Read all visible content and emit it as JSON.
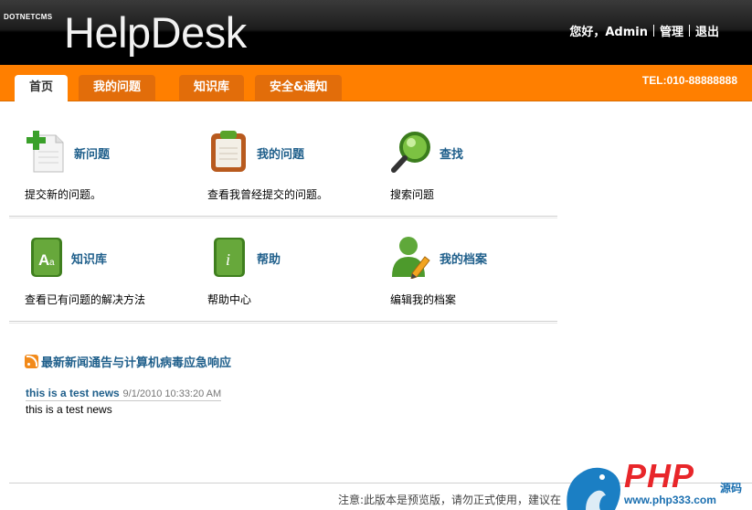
{
  "header": {
    "brand_small": "Dotnetcms",
    "brand_big": "HelpDesk",
    "greeting": "您好，Admin",
    "manage": "管理",
    "logout": "退出"
  },
  "nav": {
    "tabs": [
      {
        "label": "首页"
      },
      {
        "label": "我的问题"
      },
      {
        "label": "知识库"
      },
      {
        "label": "安全&通知"
      }
    ],
    "tel": "TEL:010-88888888"
  },
  "features": [
    {
      "title": "新问题",
      "desc": "提交新的问题。"
    },
    {
      "title": "我的问题",
      "desc": "查看我曾经提交的问题。"
    },
    {
      "title": "查找",
      "desc": "搜索问题"
    },
    {
      "title": "知识库",
      "desc": "查看已有问题的解决方法"
    },
    {
      "title": "帮助",
      "desc": "帮助中心"
    },
    {
      "title": "我的档案",
      "desc": "编辑我的档案"
    }
  ],
  "news": {
    "heading": "最新新闻通告与计算机病毒应急响应",
    "items": [
      {
        "title": "this is a test news",
        "date": "9/1/2010 10:33:20 AM",
        "body": "this is a test news"
      }
    ]
  },
  "footer": {
    "note": "注意:此版本是预览版，请勿正式使用，建议在"
  },
  "watermark": {
    "php": "PHP",
    "ym": "源码",
    "url": "www.php333.com"
  },
  "colors": {
    "nav": "#ff7f00",
    "link": "#1f5f8b",
    "header": "#000000"
  }
}
